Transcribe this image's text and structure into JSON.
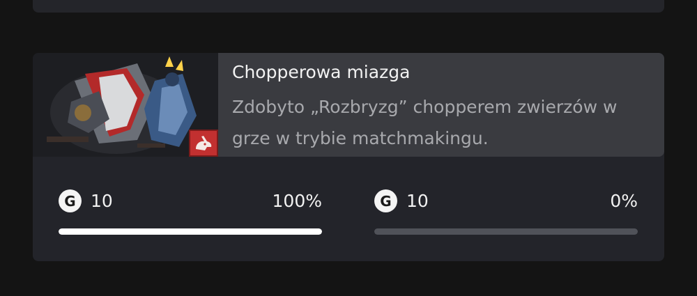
{
  "achievement": {
    "title": "Chopperowa miazga",
    "description": "Zdobyto „Rozbryzg” chopperem zwierzów w grze w trybie matchmakingu.",
    "image_icon": "wild-chopper-art",
    "badge_icon": "rabbit-head-icon",
    "badge_color": "#c23030"
  },
  "progress": [
    {
      "gamerscore_icon": "G",
      "gamerscore": "10",
      "percent_label": "100%",
      "fill": 1.0
    },
    {
      "gamerscore_icon": "G",
      "gamerscore": "10",
      "percent_label": "0%",
      "fill": 0.0
    }
  ]
}
